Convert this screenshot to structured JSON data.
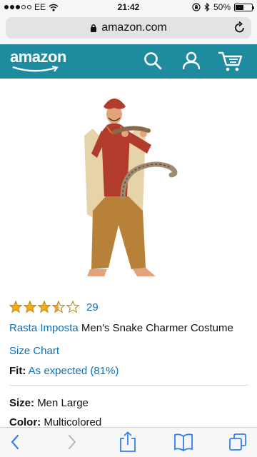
{
  "status_bar": {
    "carrier": "EE",
    "time": "21:42",
    "battery_text": "50%",
    "battery_level": 0.5
  },
  "browser": {
    "url": "amazon.com"
  },
  "header": {
    "logo": "amazon",
    "accent_color": "#1f8b9e",
    "icons": [
      "search-icon",
      "account-icon",
      "cart-icon"
    ]
  },
  "product": {
    "rating_stars": 3.5,
    "rating_count": "29",
    "brand": "Rasta Imposta",
    "title": "Men's Snake Charmer Costume",
    "size_chart_link": "Size Chart",
    "fit_label": "Fit:",
    "fit_value": "As expected (81%)",
    "size_label": "Size:",
    "size_value": "Men Large",
    "color_label": "Color:",
    "color_value": "Multicolored"
  },
  "toolbar": {
    "icons": [
      "back-icon",
      "forward-icon",
      "share-icon",
      "bookmarks-icon",
      "tabs-icon"
    ]
  },
  "link_color": "#0f6fb4",
  "star_color": "#f4a91d"
}
